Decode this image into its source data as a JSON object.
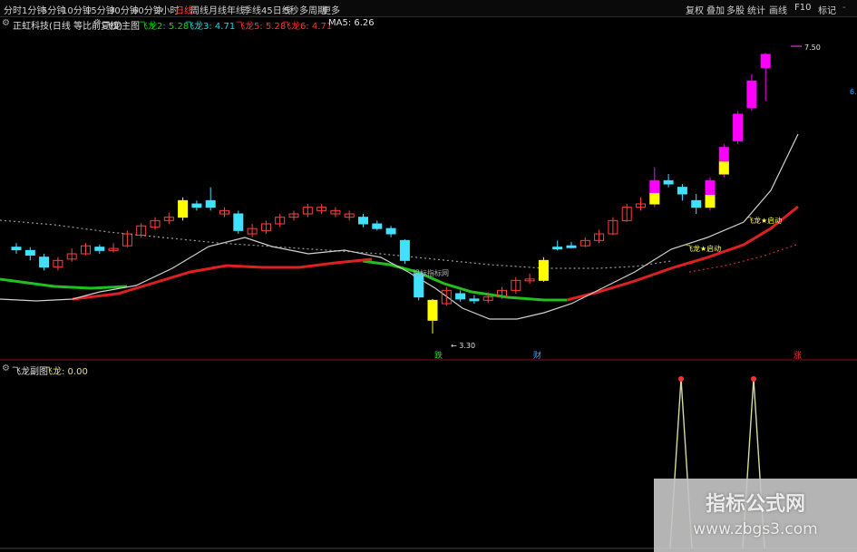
{
  "toolbar": {
    "timeframes": [
      "分时",
      "1分钟",
      "5分钟",
      "10分钟",
      "15分钟",
      "30分钟",
      "60分钟",
      "2小时",
      "日线",
      "周线",
      "月线",
      "年线",
      "季线",
      "45日线",
      "5秒",
      "多周期",
      "更多"
    ],
    "active": "日线",
    "right_items": [
      "复权",
      "叠加",
      "多股",
      "统计",
      "画线",
      "F10",
      "标记",
      "-"
    ]
  },
  "legend": {
    "stock": "正虹科技(日线 等比前复权)",
    "indicator": "飞龙主图",
    "items": [
      {
        "label": "飞龙2: 5.28",
        "color": "#00e000"
      },
      {
        "label": "飞龙3: 4.71",
        "color": "#00e0e0"
      },
      {
        "label": "飞龙5: 5.28",
        "color": "#ff3030"
      },
      {
        "label": "飞龙6: 4.71",
        "color": "#ff3030"
      },
      {
        "label": "MA5: 6.26",
        "color": "#e0e0e0"
      }
    ]
  },
  "annotations": {
    "high_price": "7.50",
    "low_price": "3.30",
    "watermark_text": "股标指标网",
    "tag_die": "跌",
    "tag_cai": "财",
    "tag_zhang": "涨",
    "signal1": "飞龙★启动",
    "signal2": "飞龙★启动",
    "axis_mark": "6."
  },
  "sub_legend": {
    "name": "飞龙副图",
    "value": "飞龙: 0.00"
  },
  "watermark": {
    "title": "指标公式网",
    "url": "www.zbgs3.com"
  },
  "colors": {
    "up": "#ff4040",
    "down": "#40e0ff",
    "signal_yellow": "#ffff00",
    "signal_magenta": "#ff00ff",
    "line_green": "#20c020",
    "line_red": "#e02020",
    "ma_white": "#d0d0d0"
  },
  "chart_data": {
    "type": "candlestick",
    "note_y_range": [
      3.0,
      7.8
    ],
    "candles": [
      {
        "o": 4.6,
        "c": 4.56,
        "h": 4.66,
        "l": 4.5,
        "kind": "down"
      },
      {
        "o": 4.55,
        "c": 4.48,
        "h": 4.6,
        "l": 4.4,
        "kind": "down"
      },
      {
        "o": 4.45,
        "c": 4.3,
        "h": 4.5,
        "l": 4.25,
        "kind": "down"
      },
      {
        "o": 4.3,
        "c": 4.4,
        "h": 4.45,
        "l": 4.25,
        "kind": "up"
      },
      {
        "o": 4.42,
        "c": 4.5,
        "h": 4.58,
        "l": 4.38,
        "kind": "up"
      },
      {
        "o": 4.5,
        "c": 4.62,
        "h": 4.66,
        "l": 4.48,
        "kind": "up"
      },
      {
        "o": 4.6,
        "c": 4.55,
        "h": 4.64,
        "l": 4.5,
        "kind": "down"
      },
      {
        "o": 4.55,
        "c": 4.58,
        "h": 4.66,
        "l": 4.52,
        "kind": "up"
      },
      {
        "o": 4.62,
        "c": 4.8,
        "h": 4.85,
        "l": 4.6,
        "kind": "up"
      },
      {
        "o": 4.78,
        "c": 4.92,
        "h": 4.96,
        "l": 4.74,
        "kind": "up"
      },
      {
        "o": 4.9,
        "c": 5.0,
        "h": 5.05,
        "l": 4.86,
        "kind": "up"
      },
      {
        "o": 5.0,
        "c": 5.05,
        "h": 5.12,
        "l": 4.95,
        "kind": "up"
      },
      {
        "o": 5.05,
        "c": 5.3,
        "h": 5.35,
        "l": 5.0,
        "kind": "yellow"
      },
      {
        "o": 5.25,
        "c": 5.2,
        "h": 5.3,
        "l": 5.15,
        "kind": "down"
      },
      {
        "o": 5.2,
        "c": 5.3,
        "h": 5.5,
        "l": 5.15,
        "kind": "down"
      },
      {
        "o": 5.15,
        "c": 5.1,
        "h": 5.2,
        "l": 5.05,
        "kind": "up"
      },
      {
        "o": 5.1,
        "c": 4.85,
        "h": 5.15,
        "l": 4.8,
        "kind": "down"
      },
      {
        "o": 4.8,
        "c": 4.88,
        "h": 4.95,
        "l": 4.75,
        "kind": "up"
      },
      {
        "o": 4.85,
        "c": 4.95,
        "h": 5.0,
        "l": 4.8,
        "kind": "up"
      },
      {
        "o": 4.95,
        "c": 5.05,
        "h": 5.1,
        "l": 4.9,
        "kind": "up"
      },
      {
        "o": 5.05,
        "c": 5.1,
        "h": 5.15,
        "l": 5.0,
        "kind": "up"
      },
      {
        "o": 5.1,
        "c": 5.2,
        "h": 5.25,
        "l": 5.05,
        "kind": "up"
      },
      {
        "o": 5.2,
        "c": 5.15,
        "h": 5.25,
        "l": 5.1,
        "kind": "up"
      },
      {
        "o": 5.15,
        "c": 5.1,
        "h": 5.2,
        "l": 5.05,
        "kind": "up"
      },
      {
        "o": 5.1,
        "c": 5.05,
        "h": 5.15,
        "l": 5.0,
        "kind": "up"
      },
      {
        "o": 5.05,
        "c": 4.95,
        "h": 5.1,
        "l": 4.9,
        "kind": "down"
      },
      {
        "o": 4.95,
        "c": 4.88,
        "h": 5.0,
        "l": 4.85,
        "kind": "down"
      },
      {
        "o": 4.88,
        "c": 4.8,
        "h": 4.92,
        "l": 4.75,
        "kind": "down"
      },
      {
        "o": 4.7,
        "c": 4.4,
        "h": 4.72,
        "l": 4.35,
        "kind": "down"
      },
      {
        "o": 4.2,
        "c": 3.85,
        "h": 4.25,
        "l": 3.8,
        "kind": "down"
      },
      {
        "o": 3.8,
        "c": 3.5,
        "h": 3.82,
        "l": 3.3,
        "kind": "yellow"
      },
      {
        "o": 3.75,
        "c": 3.95,
        "h": 4.0,
        "l": 3.72,
        "kind": "up"
      },
      {
        "o": 3.9,
        "c": 3.82,
        "h": 3.95,
        "l": 3.78,
        "kind": "down"
      },
      {
        "o": 3.82,
        "c": 3.8,
        "h": 3.88,
        "l": 3.75,
        "kind": "down"
      },
      {
        "o": 3.8,
        "c": 3.85,
        "h": 3.92,
        "l": 3.76,
        "kind": "up"
      },
      {
        "o": 3.85,
        "c": 3.95,
        "h": 4.0,
        "l": 3.82,
        "kind": "up"
      },
      {
        "o": 3.95,
        "c": 4.1,
        "h": 4.15,
        "l": 3.9,
        "kind": "up"
      },
      {
        "o": 4.1,
        "c": 4.12,
        "h": 4.2,
        "l": 4.05,
        "kind": "up"
      },
      {
        "o": 4.1,
        "c": 4.4,
        "h": 4.45,
        "l": 4.08,
        "kind": "yellow"
      },
      {
        "o": 4.58,
        "c": 4.6,
        "h": 4.7,
        "l": 4.55,
        "kind": "down"
      },
      {
        "o": 4.6,
        "c": 4.62,
        "h": 4.68,
        "l": 4.58,
        "kind": "down"
      },
      {
        "o": 4.62,
        "c": 4.7,
        "h": 4.75,
        "l": 4.6,
        "kind": "up"
      },
      {
        "o": 4.7,
        "c": 4.8,
        "h": 4.86,
        "l": 4.66,
        "kind": "up"
      },
      {
        "o": 4.8,
        "c": 5.0,
        "h": 5.05,
        "l": 4.78,
        "kind": "up"
      },
      {
        "o": 5.0,
        "c": 5.2,
        "h": 5.25,
        "l": 4.98,
        "kind": "up"
      },
      {
        "o": 5.2,
        "c": 5.25,
        "h": 5.35,
        "l": 5.15,
        "kind": "up"
      },
      {
        "o": 5.25,
        "c": 5.6,
        "h": 5.8,
        "l": 5.2,
        "kind": "yellowmag"
      },
      {
        "o": 5.6,
        "c": 5.55,
        "h": 5.7,
        "l": 5.5,
        "kind": "down"
      },
      {
        "o": 5.5,
        "c": 5.4,
        "h": 5.55,
        "l": 5.3,
        "kind": "down"
      },
      {
        "o": 5.3,
        "c": 5.2,
        "h": 5.4,
        "l": 5.1,
        "kind": "down"
      },
      {
        "o": 5.2,
        "c": 5.6,
        "h": 5.65,
        "l": 5.15,
        "kind": "yellowmag2"
      },
      {
        "o": 5.7,
        "c": 6.1,
        "h": 6.15,
        "l": 5.65,
        "kind": "yellowmag"
      },
      {
        "o": 6.2,
        "c": 6.6,
        "h": 6.65,
        "l": 6.15,
        "kind": "magenta"
      },
      {
        "o": 6.7,
        "c": 7.1,
        "h": 7.2,
        "l": 6.65,
        "kind": "magenta"
      },
      {
        "o": 7.3,
        "c": 7.5,
        "h": 7.52,
        "l": 6.8,
        "kind": "magenta"
      }
    ]
  }
}
